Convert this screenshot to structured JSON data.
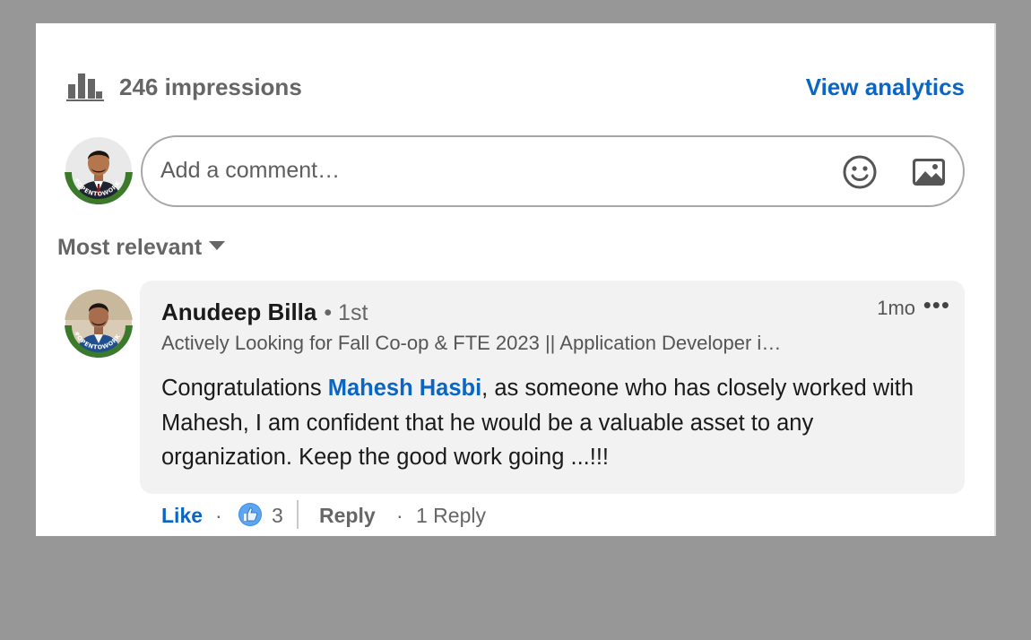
{
  "stats": {
    "impressions_text": "246 impressions",
    "view_analytics_label": "View analytics"
  },
  "composer": {
    "placeholder": "Add a comment…"
  },
  "sort": {
    "label": "Most relevant"
  },
  "comment": {
    "author_name": "Anudeep Billa",
    "degree": "• 1st",
    "timestamp": "1mo",
    "more_label": "•••",
    "headline": "Actively Looking for Fall Co-op & FTE 2023 || Application Developer i…",
    "text_before": "Congratulations ",
    "mention": "Mahesh Hasbi",
    "text_after": ", as someone who has closely worked with Mahesh, I am confident that he would be a valuable asset to any organization. Keep the good work going ...!!!"
  },
  "actions": {
    "like_label": "Like",
    "separator": "·",
    "reaction_count": "3",
    "reply_label": "Reply",
    "replies_text": "1 Reply"
  },
  "avatars": {
    "frame_text": "#OPENTOWORK",
    "frame_color": "#3b7a2a"
  },
  "icons": {
    "analytics": "bar-chart-icon",
    "emoji": "smiley-icon",
    "image": "image-icon",
    "reaction": "thumbs-up-icon"
  },
  "colors": {
    "accent": "#0a66c2",
    "page_background": "#979797",
    "bubble": "#f2f2f2"
  }
}
